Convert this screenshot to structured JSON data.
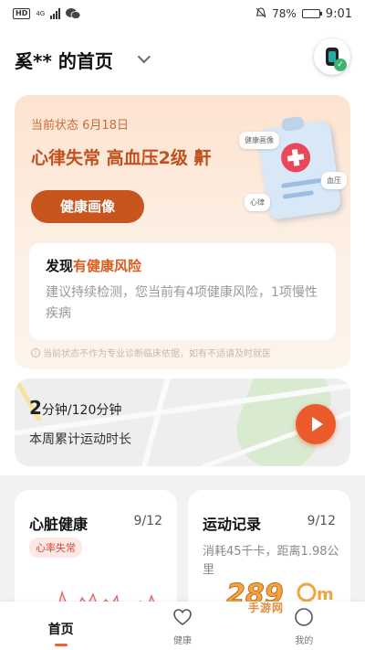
{
  "status_bar": {
    "left_badges": [
      "HD",
      "4G"
    ],
    "battery": "78%",
    "battery_level": 0.78,
    "time": "9:01"
  },
  "header": {
    "title": "奚** 的首页",
    "watch_icon": "smartwatch-icon"
  },
  "health_card": {
    "date_label": "当前状态 6月18日",
    "status_text": "心律失常 高血压2级 鼾",
    "button_label": "健康画像",
    "illustration_tags": [
      "健康画像",
      "血压",
      "心律"
    ],
    "risk_prefix": "发现",
    "risk_highlight": "有健康风险",
    "risk_desc": "建议持续检测，您当前有4项健康风险，1项慢性疾病",
    "disclaimer": "当前状态不作为专业诊断临床依据，如有不适请及时就医",
    "accent_color": "#c8551e"
  },
  "exercise_card": {
    "value": "2",
    "unit_and_goal": "分钟/120分钟",
    "label": "本周累计运动时长",
    "play_icon": "play-icon"
  },
  "heart_card": {
    "title": "心脏健康",
    "date": "9/12",
    "badge": "心率失常"
  },
  "sport_card": {
    "title": "运动记录",
    "date": "9/12",
    "desc": "消耗45千卡，距离1.98公里"
  },
  "bottom_nav": {
    "items": [
      {
        "label": "首页",
        "icon": "home-icon",
        "active": true
      },
      {
        "label": "健康",
        "icon": "heart-icon",
        "active": false
      },
      {
        "label": "我的",
        "icon": "profile-icon",
        "active": false
      }
    ]
  },
  "watermark": {
    "brand": "289",
    "site": "手游网"
  }
}
